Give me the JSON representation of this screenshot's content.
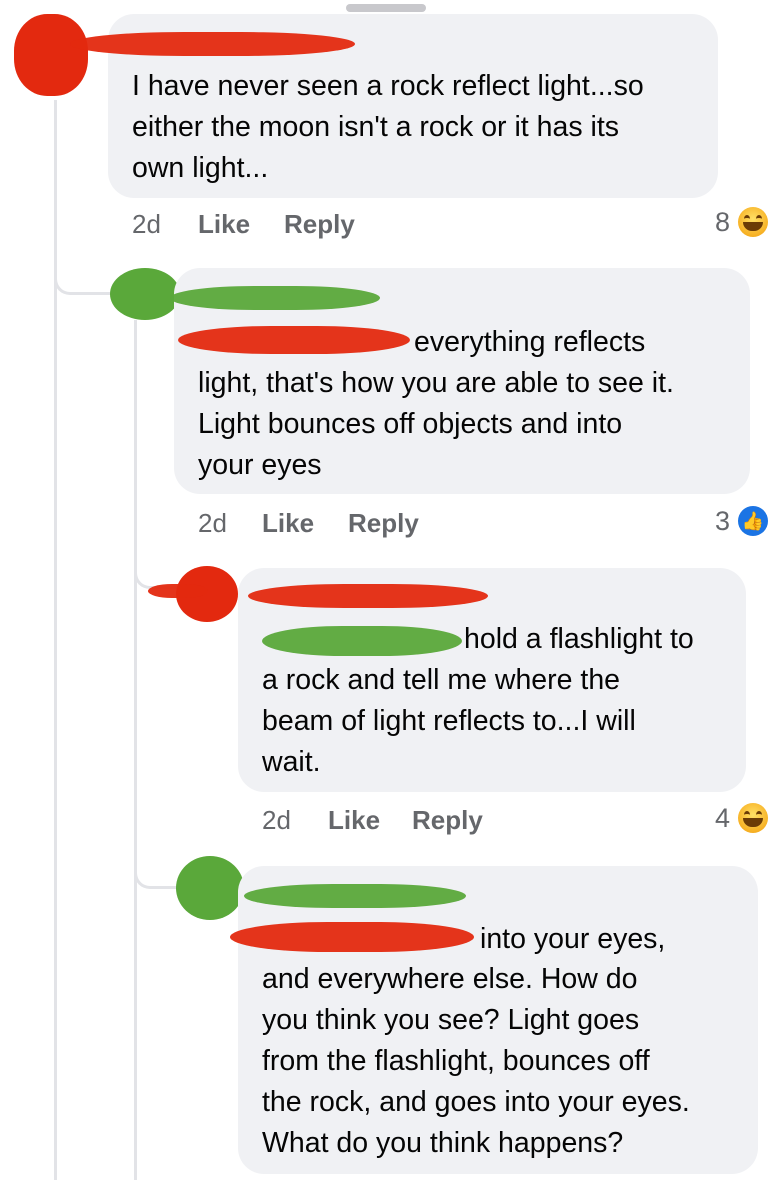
{
  "comments": [
    {
      "text_lines": [
        "I have never seen a rock reflect light...so",
        "either the moon isn't a rock or it has its",
        "own light..."
      ],
      "time": "2d",
      "like_label": "Like",
      "reply_label": "Reply",
      "reaction_count": "8",
      "reaction_icon": "haha-emoji-icon"
    },
    {
      "text_lines": [
        "everything reflects",
        "light, that's how you are able to see it.",
        "Light bounces off objects and into",
        "your eyes"
      ],
      "time": "2d",
      "like_label": "Like",
      "reply_label": "Reply",
      "reaction_count": "3",
      "reaction_icon": "like-icon"
    },
    {
      "text_lines": [
        "hold a flashlight to",
        "a rock and tell me where the",
        "beam of light reflects to...I will",
        "wait."
      ],
      "time": "2d",
      "like_label": "Like",
      "reply_label": "Reply",
      "reaction_count": "4",
      "reaction_icon": "haha-emoji-icon"
    },
    {
      "text_lines": [
        "into your eyes,",
        "and everywhere else.  How do",
        "you think you see?  Light goes",
        "from the flashlight, bounces off",
        "the rock, and goes into your eyes.",
        "What do you think happens?"
      ]
    }
  ],
  "colors": {
    "bubble": "#f0f1f4",
    "meta": "#65676b",
    "redaction_red": "#e3290f",
    "redaction_green": "#5aa83a",
    "like_blue": "#1b74e4"
  }
}
